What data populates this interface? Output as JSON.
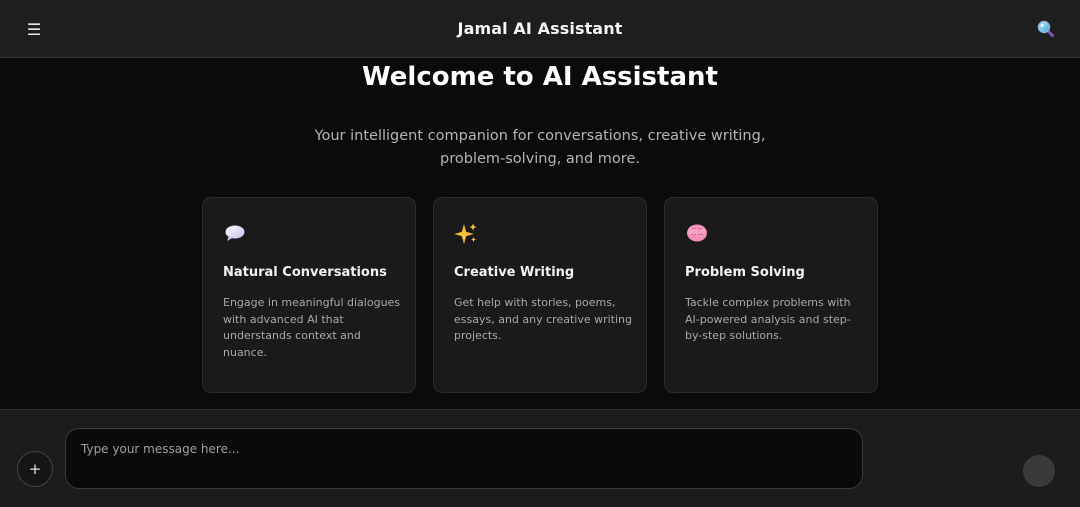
{
  "header": {
    "menu_icon": "hamburger-menu-icon",
    "menu_glyph": "☰",
    "title": "Jamal AI Assistant",
    "search_icon": "search-icon"
  },
  "main": {
    "welcome_title": "Welcome to AI Assistant",
    "subtitle": "Your intelligent companion for conversations, creative writing, problem-solving, and more.",
    "cards": [
      {
        "icon": "speech-balloon-icon",
        "title": "Natural Conversations",
        "description": "Engage in meaningful dialogues with advanced AI that understands context and nuance."
      },
      {
        "icon": "sparkles-icon",
        "title": "Creative Writing",
        "description": "Get help with stories, poems, essays, and any creative writing projects."
      },
      {
        "icon": "brain-icon",
        "title": "Problem Solving",
        "description": "Tackle complex problems with AI-powered analysis and step-by-step solutions."
      }
    ]
  },
  "composer": {
    "attach_label": "+",
    "input_placeholder": "Type your message here...",
    "input_value": "",
    "send_icon": "send-icon"
  },
  "colors": {
    "background": "#0a0a0a",
    "header_background": "#1e1e1e",
    "card_background": "#1a1a1a",
    "text_primary": "#ffffff",
    "text_secondary": "#a8a8a8",
    "send_button": "#3a3a3a"
  }
}
